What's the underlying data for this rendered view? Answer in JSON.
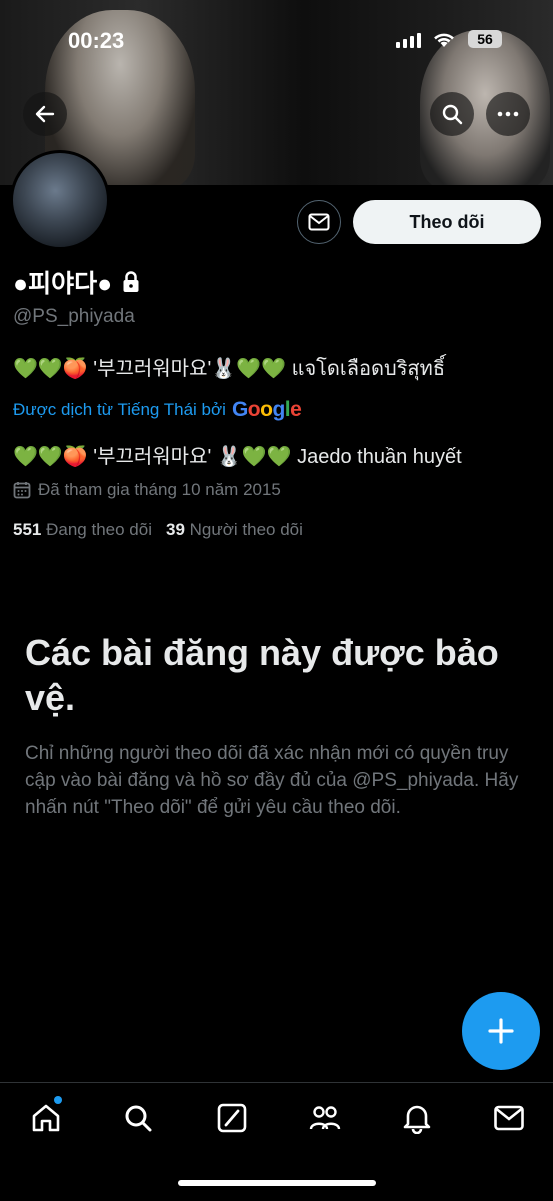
{
  "status_bar": {
    "time": "00:23",
    "battery": "56"
  },
  "profile": {
    "display_name": "●피야다●",
    "handle": "@PS_phiyada",
    "bio": "💚💚🍑 '부끄러워마요'🐰💚💚 แจโดเลือดบริสุทธิ์",
    "translated_from": "Được dịch từ Tiếng Thái bởi",
    "translator": "Google",
    "bio_translation": "💚💚🍑 '부끄러워마요' 🐰💚💚 Jaedo thuần huyết",
    "joined": "Đã tham gia tháng 10 năm 2015",
    "following_count": "551",
    "following_label": "Đang theo dõi",
    "followers_count": "39",
    "followers_label": "Người theo dõi"
  },
  "buttons": {
    "follow": "Theo dõi"
  },
  "protected": {
    "title": "Các bài đăng này được bảo vệ.",
    "description": "Chỉ những người theo dõi đã xác nhận mới có quyền truy cập vào bài đăng và hồ sơ đầy đủ của @PS_phiyada. Hãy nhấn nút \"Theo dõi\" để gửi yêu cầu theo dõi."
  },
  "icons": {
    "back": "back-arrow-icon",
    "search": "search-icon",
    "more": "more-icon",
    "message": "mail-icon",
    "lock": "lock-icon",
    "calendar": "calendar-icon",
    "compose": "plus-icon"
  },
  "nav": [
    "home-icon",
    "search-icon",
    "grok-icon",
    "communities-icon",
    "notifications-icon",
    "messages-icon"
  ],
  "colors": {
    "accent": "#1d9bf0",
    "background": "#000000",
    "muted": "#71767b"
  }
}
